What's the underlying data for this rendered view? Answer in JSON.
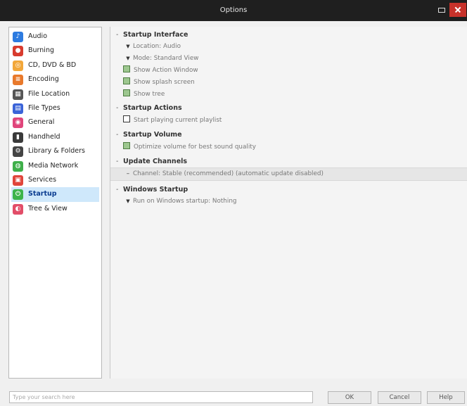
{
  "window": {
    "title": "Options"
  },
  "sidebar": {
    "items": [
      {
        "label": "Audio",
        "icon": "music-note-icon",
        "color": "#2d7be0",
        "glyph": "♪"
      },
      {
        "label": "Burning",
        "icon": "burn-disc-icon",
        "color": "#d83b2e",
        "glyph": "●"
      },
      {
        "label": "CD, DVD & BD",
        "icon": "disc-icon",
        "color": "#f2a73a",
        "glyph": "◎"
      },
      {
        "label": "Encoding",
        "icon": "encoding-icon",
        "color": "#e8792b",
        "glyph": "≡"
      },
      {
        "label": "File Location",
        "icon": "file-location-icon",
        "color": "#555555",
        "glyph": "▦"
      },
      {
        "label": "File Types",
        "icon": "file-types-icon",
        "color": "#3b64d8",
        "glyph": "▤"
      },
      {
        "label": "General",
        "icon": "general-icon",
        "color": "#e0457b",
        "glyph": "◉"
      },
      {
        "label": "Handheld",
        "icon": "handheld-icon",
        "color": "#3a3a3a",
        "glyph": "▮"
      },
      {
        "label": "Library & Folders",
        "icon": "library-icon",
        "color": "#444444",
        "glyph": "⚙"
      },
      {
        "label": "Media Network",
        "icon": "media-network-icon",
        "color": "#3faf4a",
        "glyph": "◍"
      },
      {
        "label": "Services",
        "icon": "services-icon",
        "color": "#e0453b",
        "glyph": "▣"
      },
      {
        "label": "Startup",
        "icon": "startup-icon",
        "color": "#3db44a",
        "glyph": "⏻",
        "selected": true
      },
      {
        "label": "Tree & View",
        "icon": "tree-view-icon",
        "color": "#e24d68",
        "glyph": "◐"
      }
    ]
  },
  "main": {
    "startup_interface": {
      "title": "Startup Interface",
      "location": "Location: Audio",
      "mode": "Mode: Standard View",
      "show_action_window": "Show Action Window",
      "show_splash": "Show splash screen",
      "show_tree": "Show tree"
    },
    "startup_actions": {
      "title": "Startup Actions",
      "start_playing": "Start playing current playlist"
    },
    "startup_volume": {
      "title": "Startup Volume",
      "optimize": "Optimize volume for best sound quality"
    },
    "update_channels": {
      "title": "Update Channels",
      "channel": "Channel: Stable (recommended) (automatic update disabled)"
    },
    "windows_startup": {
      "title": "Windows Startup",
      "run_on": "Run on Windows startup: Nothing"
    }
  },
  "footer": {
    "search_placeholder": "Type your search here",
    "ok": "OK",
    "cancel": "Cancel",
    "help": "Help"
  }
}
